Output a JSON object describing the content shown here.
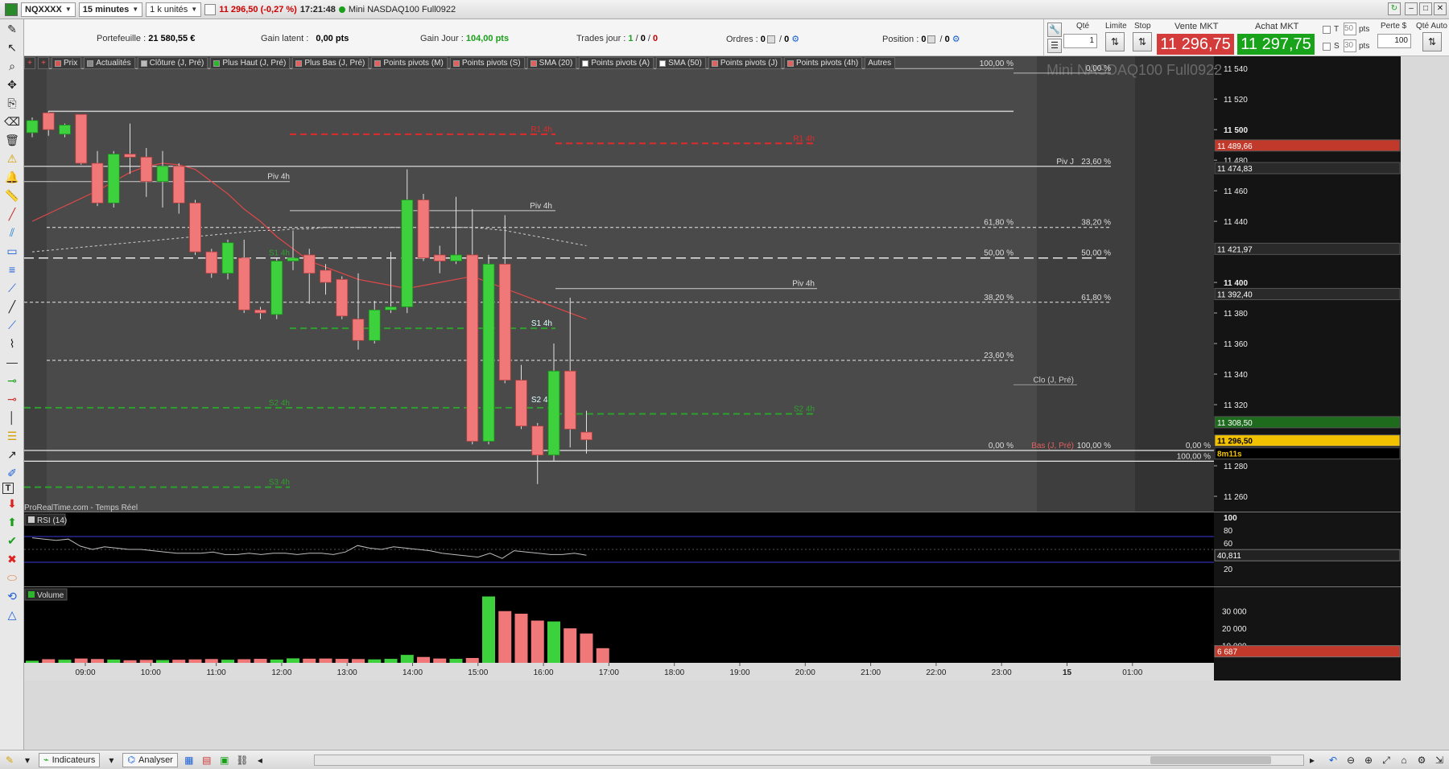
{
  "topbar": {
    "symbol": "NQXXXX",
    "timeframe": "15 minutes",
    "units": "1 k unités",
    "price_change": "11 296,50 (-0,27 %)",
    "time": "17:21:48",
    "instrument": "Mini NASDAQ100 Full0922"
  },
  "portfolio": {
    "portefeuille_label": "Portefeuille :",
    "portefeuille_value": "21 580,55 €",
    "gain_latent_label": "Gain latent :",
    "gain_latent_value": "0,00 pts",
    "gain_jour_label": "Gain Jour :",
    "gain_jour_value": "104,00 pts",
    "trades_label": "Trades jour :",
    "trades_a": "1",
    "trades_b": "0",
    "trades_c": "0",
    "ordres_label": "Ordres :",
    "ordres_a": "0",
    "ordres_b": "0",
    "position_label": "Position :",
    "position_value": "0"
  },
  "order": {
    "qte_label": "Qté",
    "qte_value": "1",
    "limite_label": "Limite",
    "stop_label": "Stop",
    "vente_label": "Vente MKT",
    "vente_price": "11 296,75",
    "achat_label": "Achat MKT",
    "achat_price": "11 297,75",
    "t_label": "T",
    "t_value": "50",
    "s_label": "S",
    "s_value": "30",
    "pts": "pts",
    "perte_label": "Perte $",
    "perte_value": "100",
    "qte_auto_label": "Qté Auto"
  },
  "chips": [
    {
      "label": "Prix",
      "color": "#d9534f"
    },
    {
      "label": "Actualités",
      "color": "#888888"
    },
    {
      "label": "Clôture (J, Pré)",
      "color": "#bbbbbb"
    },
    {
      "label": "Plus Haut (J, Pré)",
      "color": "#2db52d"
    },
    {
      "label": "Plus Bas (J, Pré)",
      "color": "#e06060"
    },
    {
      "label": "Points pivots (M)",
      "color": "#e06060"
    },
    {
      "label": "Points pivots (S)",
      "color": "#e06060"
    },
    {
      "label": "SMA (20)",
      "color": "#e06060"
    },
    {
      "label": "Points pivots (A)",
      "color": "#ffffff"
    },
    {
      "label": "SMA (50)",
      "color": "#ffffff"
    },
    {
      "label": "Points pivots (J)",
      "color": "#e06060"
    },
    {
      "label": "Points pivots (4h)",
      "color": "#e06060"
    },
    {
      "label": "Autres",
      "color": ""
    }
  ],
  "chart": {
    "watermark": "Mini NASDAQ100 Full0922",
    "source": "ProRealTime.com - Temps Réel",
    "y_ticks": [
      "11 540",
      "11 520",
      "11 500",
      "11 480",
      "11 460",
      "11 440",
      "11 400",
      "11 380",
      "11 360",
      "11 340",
      "11 320",
      "11 280",
      "11 260"
    ],
    "right_tags": [
      {
        "text": "11 489,66",
        "color": "#c0392b"
      },
      {
        "text": "11 474,83",
        "color": "#2a2a2a"
      },
      {
        "text": "11 421,97",
        "color": "#2a2a2a"
      },
      {
        "text": "11 392,40",
        "color": "#2a2a2a"
      },
      {
        "text": "11 308,50",
        "color": "#1e6b1e"
      },
      {
        "text": "11 296,50",
        "color": "#f2c200"
      },
      {
        "text": "8m11s",
        "color": "#000000"
      }
    ],
    "level_labels": {
      "fib_left": [
        "100,00 %",
        "61,80 %",
        "50,00 %",
        "38,20 %",
        "23,60 %",
        "0,00 %"
      ],
      "fib_right": [
        "0,00 %",
        "23,60 %",
        "38,20 %",
        "50,00 %",
        "61,80 %",
        "100,00 %"
      ],
      "piv_j": "Piv J",
      "piv_4h": "Piv 4h",
      "r1_4h": "R1 4h",
      "s1_4h": "S1 4h",
      "s2_4h": "S2 4h",
      "s3_4h": "S3 4h",
      "clo": "Clo (J, Pré)",
      "bas": "Bas (J, Pré)",
      "far_right_0": "0,00 %",
      "far_right_100": "100,00 %"
    },
    "x_ticks": [
      "09:00",
      "10:00",
      "11:00",
      "12:00",
      "13:00",
      "14:00",
      "15:00",
      "16:00",
      "17:00",
      "18:00",
      "19:00",
      "20:00",
      "21:00",
      "22:00",
      "23:00",
      "15",
      "01:00"
    ]
  },
  "rsi": {
    "label": "RSI (14)",
    "ticks": [
      "100",
      "80",
      "60",
      "40",
      "20"
    ],
    "value": "40,811"
  },
  "volume": {
    "label": "Volume",
    "ticks": [
      "30 000",
      "20 000",
      "10 000"
    ],
    "value": "6 687"
  },
  "bottombar": {
    "indicateurs": "Indicateurs",
    "analyser": "Analyser"
  },
  "chart_data": {
    "type": "candlestick",
    "candles": [
      {
        "t": "08:45",
        "o": 11498,
        "h": 11508,
        "l": 11495,
        "c": 11506
      },
      {
        "t": "09:00",
        "o": 11511,
        "h": 11512,
        "l": 11496,
        "c": 11500
      },
      {
        "t": "09:15",
        "o": 11497,
        "h": 11504,
        "l": 11495,
        "c": 11503
      },
      {
        "t": "09:30",
        "o": 11510,
        "h": 11510,
        "l": 11477,
        "c": 11478
      },
      {
        "t": "09:45",
        "o": 11478,
        "h": 11486,
        "l": 11450,
        "c": 11452
      },
      {
        "t": "10:00",
        "o": 11452,
        "h": 11486,
        "l": 11449,
        "c": 11484
      },
      {
        "t": "10:15",
        "o": 11484,
        "h": 11504,
        "l": 11471,
        "c": 11482
      },
      {
        "t": "10:30",
        "o": 11482,
        "h": 11488,
        "l": 11456,
        "c": 11466
      },
      {
        "t": "10:45",
        "o": 11466,
        "h": 11486,
        "l": 11449,
        "c": 11476
      },
      {
        "t": "11:00",
        "o": 11476,
        "h": 11478,
        "l": 11445,
        "c": 11452
      },
      {
        "t": "11:15",
        "o": 11452,
        "h": 11454,
        "l": 11418,
        "c": 11420
      },
      {
        "t": "11:30",
        "o": 11420,
        "h": 11422,
        "l": 11403,
        "c": 11406
      },
      {
        "t": "11:45",
        "o": 11406,
        "h": 11428,
        "l": 11402,
        "c": 11426
      },
      {
        "t": "12:00",
        "o": 11416,
        "h": 11428,
        "l": 11380,
        "c": 11382
      },
      {
        "t": "12:15",
        "o": 11382,
        "h": 11384,
        "l": 11376,
        "c": 11380
      },
      {
        "t": "12:30",
        "o": 11379,
        "h": 11416,
        "l": 11376,
        "c": 11414
      },
      {
        "t": "12:45",
        "o": 11414,
        "h": 11434,
        "l": 11408,
        "c": 11416
      },
      {
        "t": "13:00",
        "o": 11418,
        "h": 11422,
        "l": 11386,
        "c": 11406
      },
      {
        "t": "13:15",
        "o": 11408,
        "h": 11412,
        "l": 11392,
        "c": 11400
      },
      {
        "t": "13:30",
        "o": 11402,
        "h": 11404,
        "l": 11376,
        "c": 11378
      },
      {
        "t": "13:45",
        "o": 11376,
        "h": 11406,
        "l": 11356,
        "c": 11362
      },
      {
        "t": "14:00",
        "o": 11362,
        "h": 11388,
        "l": 11360,
        "c": 11382
      },
      {
        "t": "14:15",
        "o": 11382,
        "h": 11420,
        "l": 11380,
        "c": 11384
      },
      {
        "t": "14:30",
        "o": 11384,
        "h": 11474,
        "l": 11380,
        "c": 11454
      },
      {
        "t": "14:45",
        "o": 11454,
        "h": 11458,
        "l": 11414,
        "c": 11416
      },
      {
        "t": "15:00",
        "o": 11418,
        "h": 11424,
        "l": 11406,
        "c": 11414
      },
      {
        "t": "15:15",
        "o": 11414,
        "h": 11456,
        "l": 11412,
        "c": 11418
      },
      {
        "t": "15:30",
        "o": 11418,
        "h": 11448,
        "l": 11294,
        "c": 11296
      },
      {
        "t": "15:45",
        "o": 11296,
        "h": 11418,
        "l": 11294,
        "c": 11412
      },
      {
        "t": "16:00",
        "o": 11412,
        "h": 11444,
        "l": 11334,
        "c": 11336
      },
      {
        "t": "16:15",
        "o": 11336,
        "h": 11346,
        "l": 11304,
        "c": 11306
      },
      {
        "t": "16:30",
        "o": 11306,
        "h": 11308,
        "l": 11268,
        "c": 11287
      },
      {
        "t": "16:45",
        "o": 11287,
        "h": 11360,
        "l": 11283,
        "c": 11342
      },
      {
        "t": "17:00",
        "o": 11342,
        "h": 11390,
        "l": 11292,
        "c": 11304
      },
      {
        "t": "17:15",
        "o": 11302,
        "h": 11316,
        "l": 11288,
        "c": 11297
      }
    ],
    "sma20": [
      11440,
      11445,
      11450,
      11455,
      11460,
      11466,
      11472,
      11476,
      11478,
      11477,
      11474,
      11466,
      11458,
      11448,
      11440,
      11430,
      11422,
      11414,
      11410,
      11406,
      11402,
      11400,
      11398,
      11396,
      11398,
      11400,
      11402,
      11404,
      11400,
      11396,
      11392,
      11388,
      11384,
      11380,
      11376
    ],
    "sma50": [
      11420,
      11421,
      11422,
      11423,
      11424,
      11425,
      11426,
      11427,
      11428,
      11429,
      11430,
      11431,
      11432,
      11433,
      11434,
      11434,
      11435,
      11435,
      11436,
      11436,
      11436,
      11436,
      11436,
      11436,
      11436,
      11436,
      11436,
      11436,
      11435,
      11434,
      11432,
      11430,
      11428,
      11426,
      11424
    ],
    "rsi": [
      68,
      66,
      64,
      66,
      55,
      50,
      54,
      52,
      50,
      50,
      48,
      46,
      44,
      44,
      44,
      46,
      42,
      42,
      44,
      42,
      44,
      44,
      42,
      44,
      44,
      42,
      46,
      56,
      52,
      50,
      54,
      52,
      50,
      48,
      44,
      42,
      40,
      38,
      44,
      36,
      48,
      46,
      44,
      42,
      42,
      44,
      41
    ],
    "volume": [
      1200,
      2100,
      1800,
      2500,
      2200,
      1900,
      1500,
      1700,
      1600,
      1800,
      2000,
      2200,
      1800,
      2100,
      2300,
      1900,
      2600,
      2400,
      2500,
      2300,
      2200,
      2000,
      2300,
      4600,
      3400,
      2500,
      2300,
      2800,
      38500,
      30000,
      28500,
      24500,
      24000,
      20000,
      17000,
      8500
    ],
    "ylim": [
      11250,
      11548
    ]
  }
}
